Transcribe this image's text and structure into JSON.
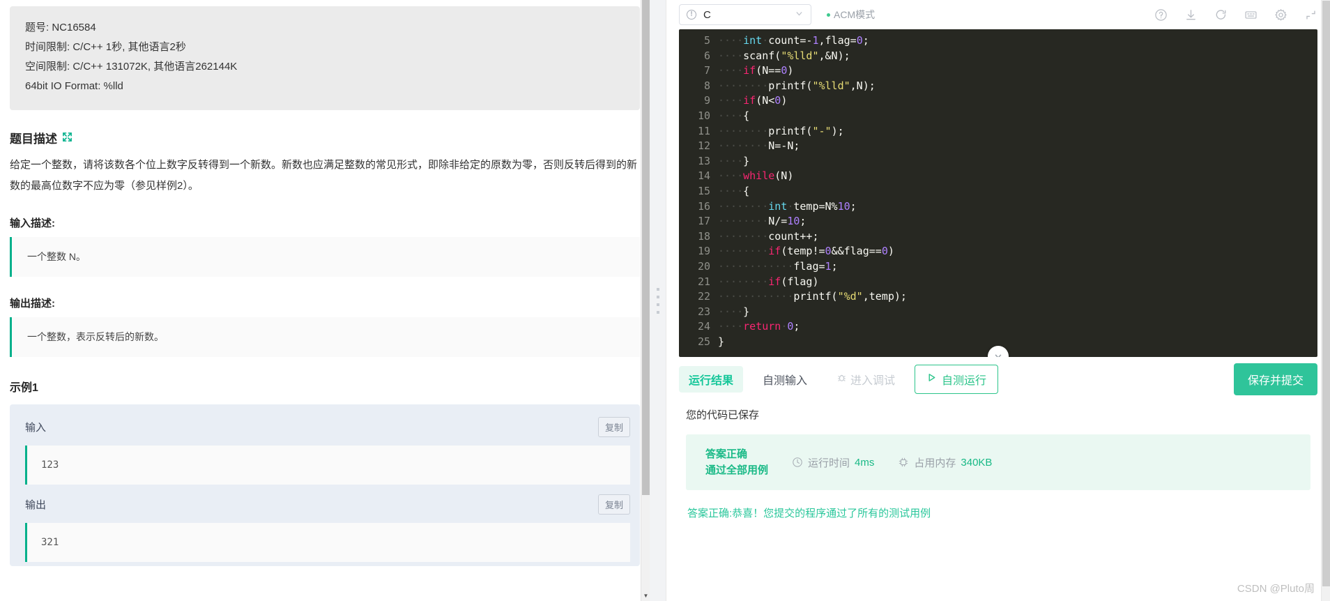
{
  "problem": {
    "meta": [
      "题号: NC16584",
      "时间限制: C/C++ 1秒, 其他语言2秒",
      "空间限制: C/C++ 131072K, 其他语言262144K",
      "64bit IO Format: %lld"
    ],
    "description_title": "题目描述",
    "expand_icon": "expand-icon",
    "description": "给定一个整数，请将该数各个位上数字反转得到一个新数。新数也应满足整数的常见形式，即除非给定的原数为零，否则反转后得到的新数的最高位数字不应为零（参见样例2）。",
    "input_desc_title": "输入描述:",
    "input_desc": "一个整数 N。",
    "output_desc_title": "输出描述:",
    "output_desc": "一个整数，表示反转后的新数。",
    "example_title": "示例1",
    "example": {
      "input_label": "输入",
      "input_value": "123",
      "output_label": "输出",
      "output_value": "321",
      "copy_label": "复制"
    }
  },
  "editor": {
    "language": "C",
    "language_warn_icon": "warning-circle-icon",
    "chevron_icon": "chevron-down-icon",
    "acm_mode_label": "ACM模式",
    "toolbar_icons": [
      "help-icon",
      "download-icon",
      "refresh-icon",
      "console-icon",
      "settings-gear-icon",
      "fullscreen-icon"
    ],
    "collapse_icon": "chevron-down-icon",
    "code": [
      {
        "n": "5",
        "tokens": [
          {
            "t": "····",
            "c": "dot"
          },
          {
            "t": "int",
            "c": "ty"
          },
          {
            "t": "·",
            "c": "dot"
          },
          {
            "t": "count=-",
            "c": "code-txt"
          },
          {
            "t": "1",
            "c": "num"
          },
          {
            "t": ",flag=",
            "c": "code-txt"
          },
          {
            "t": "0",
            "c": "num"
          },
          {
            "t": ";",
            "c": "code-txt"
          }
        ]
      },
      {
        "n": "6",
        "tokens": [
          {
            "t": "····",
            "c": "dot"
          },
          {
            "t": "scanf(",
            "c": "code-txt"
          },
          {
            "t": "\"%lld\"",
            "c": "str"
          },
          {
            "t": ",&N);",
            "c": "code-txt"
          }
        ]
      },
      {
        "n": "7",
        "tokens": [
          {
            "t": "····",
            "c": "dot"
          },
          {
            "t": "if",
            "c": "kw"
          },
          {
            "t": "(N==",
            "c": "code-txt"
          },
          {
            "t": "0",
            "c": "num"
          },
          {
            "t": ")",
            "c": "code-txt"
          }
        ]
      },
      {
        "n": "8",
        "tokens": [
          {
            "t": "········",
            "c": "dot"
          },
          {
            "t": "printf(",
            "c": "code-txt"
          },
          {
            "t": "\"%lld\"",
            "c": "str"
          },
          {
            "t": ",N);",
            "c": "code-txt"
          }
        ]
      },
      {
        "n": "9",
        "tokens": [
          {
            "t": "····",
            "c": "dot"
          },
          {
            "t": "if",
            "c": "kw"
          },
          {
            "t": "(N<",
            "c": "code-txt"
          },
          {
            "t": "0",
            "c": "num"
          },
          {
            "t": ")",
            "c": "code-txt"
          }
        ]
      },
      {
        "n": "10",
        "tokens": [
          {
            "t": "····",
            "c": "dot"
          },
          {
            "t": "{",
            "c": "code-txt"
          }
        ]
      },
      {
        "n": "11",
        "tokens": [
          {
            "t": "········",
            "c": "dot"
          },
          {
            "t": "printf(",
            "c": "code-txt"
          },
          {
            "t": "\"-\"",
            "c": "str"
          },
          {
            "t": ");",
            "c": "code-txt"
          }
        ]
      },
      {
        "n": "12",
        "tokens": [
          {
            "t": "········",
            "c": "dot"
          },
          {
            "t": "N=-N;",
            "c": "code-txt"
          }
        ]
      },
      {
        "n": "13",
        "tokens": [
          {
            "t": "····",
            "c": "dot"
          },
          {
            "t": "}",
            "c": "code-txt"
          }
        ]
      },
      {
        "n": "14",
        "tokens": [
          {
            "t": "····",
            "c": "dot"
          },
          {
            "t": "while",
            "c": "kw"
          },
          {
            "t": "(N)",
            "c": "code-txt"
          }
        ]
      },
      {
        "n": "15",
        "tokens": [
          {
            "t": "····",
            "c": "dot"
          },
          {
            "t": "{",
            "c": "code-txt"
          }
        ]
      },
      {
        "n": "16",
        "tokens": [
          {
            "t": "········",
            "c": "dot"
          },
          {
            "t": "int",
            "c": "ty"
          },
          {
            "t": "·",
            "c": "dot"
          },
          {
            "t": "temp=N%",
            "c": "code-txt"
          },
          {
            "t": "10",
            "c": "num"
          },
          {
            "t": ";",
            "c": "code-txt"
          }
        ]
      },
      {
        "n": "17",
        "tokens": [
          {
            "t": "········",
            "c": "dot"
          },
          {
            "t": "N/=",
            "c": "code-txt"
          },
          {
            "t": "10",
            "c": "num"
          },
          {
            "t": ";",
            "c": "code-txt"
          }
        ]
      },
      {
        "n": "18",
        "tokens": [
          {
            "t": "········",
            "c": "dot"
          },
          {
            "t": "count++;",
            "c": "code-txt"
          }
        ]
      },
      {
        "n": "19",
        "tokens": [
          {
            "t": "········",
            "c": "dot"
          },
          {
            "t": "if",
            "c": "kw"
          },
          {
            "t": "(temp!=",
            "c": "code-txt"
          },
          {
            "t": "0",
            "c": "num"
          },
          {
            "t": "&&flag==",
            "c": "code-txt"
          },
          {
            "t": "0",
            "c": "num"
          },
          {
            "t": ")",
            "c": "code-txt"
          }
        ]
      },
      {
        "n": "20",
        "tokens": [
          {
            "t": "············",
            "c": "dot"
          },
          {
            "t": "flag=",
            "c": "code-txt"
          },
          {
            "t": "1",
            "c": "num"
          },
          {
            "t": ";",
            "c": "code-txt"
          }
        ]
      },
      {
        "n": "21",
        "tokens": [
          {
            "t": "········",
            "c": "dot"
          },
          {
            "t": "if",
            "c": "kw"
          },
          {
            "t": "(flag)",
            "c": "code-txt"
          }
        ]
      },
      {
        "n": "22",
        "tokens": [
          {
            "t": "············",
            "c": "dot"
          },
          {
            "t": "printf(",
            "c": "code-txt"
          },
          {
            "t": "\"%d\"",
            "c": "str"
          },
          {
            "t": ",temp);",
            "c": "code-txt"
          }
        ]
      },
      {
        "n": "23",
        "tokens": [
          {
            "t": "····",
            "c": "dot"
          },
          {
            "t": "}",
            "c": "code-txt"
          }
        ]
      },
      {
        "n": "24",
        "tokens": [
          {
            "t": "····",
            "c": "dot"
          },
          {
            "t": "return",
            "c": "kw"
          },
          {
            "t": "·",
            "c": "dot"
          },
          {
            "t": "0",
            "c": "num"
          },
          {
            "t": ";",
            "c": "code-txt"
          }
        ]
      },
      {
        "n": "25",
        "tokens": [
          {
            "t": "}",
            "c": "code-txt"
          }
        ]
      }
    ]
  },
  "runbar": {
    "tabs": [
      {
        "label": "运行结果",
        "state": "active"
      },
      {
        "label": "自测输入",
        "state": "normal"
      },
      {
        "label": "进入调试",
        "state": "disabled",
        "icon": "bug-icon"
      }
    ],
    "run_button": {
      "label": "自测运行",
      "icon": "play-icon"
    },
    "submit_button": "保存并提交"
  },
  "results": {
    "saved_text": "您的代码已保存",
    "verdict_line1": "答案正确",
    "verdict_line2": "通过全部用例",
    "time_label": "运行时间",
    "time_value": "4ms",
    "time_icon": "clock-icon",
    "memory_label": "占用内存",
    "memory_value": "340KB",
    "memory_icon": "chip-icon",
    "final_message": "答案正确:恭喜！您提交的程序通过了所有的测试用例"
  },
  "watermark": "CSDN @Pluto周",
  "colors": {
    "accent_green": "#2fc49a",
    "verdict_green": "#19b986",
    "editor_bg": "#272822"
  }
}
